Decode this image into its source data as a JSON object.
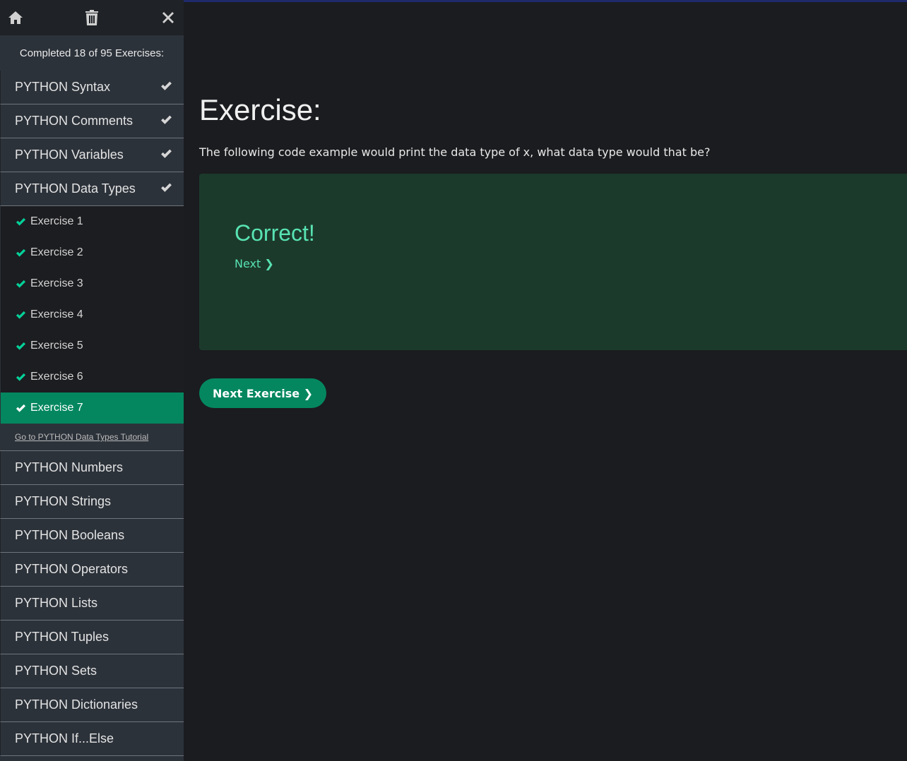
{
  "toolbar": {
    "home_icon": "home-icon",
    "trash_icon": "trash-icon",
    "close_icon": "close-icon"
  },
  "progress_text": "Completed 18 of 95 Exercises:",
  "sections_top": [
    {
      "label": "PYTHON Syntax",
      "completed": true
    },
    {
      "label": "PYTHON Comments",
      "completed": true
    },
    {
      "label": "PYTHON Variables",
      "completed": true
    },
    {
      "label": "PYTHON Data Types",
      "completed": true
    }
  ],
  "sub_exercises": [
    {
      "label": "Exercise 1"
    },
    {
      "label": "Exercise 2"
    },
    {
      "label": "Exercise 3"
    },
    {
      "label": "Exercise 4"
    },
    {
      "label": "Exercise 5"
    },
    {
      "label": "Exercise 6"
    },
    {
      "label": "Exercise 7"
    }
  ],
  "tutorial_link": "Go to PYTHON Data Types Tutorial",
  "sections_bottom": [
    {
      "label": "PYTHON Numbers"
    },
    {
      "label": "PYTHON Strings"
    },
    {
      "label": "PYTHON Booleans"
    },
    {
      "label": "PYTHON Operators"
    },
    {
      "label": "PYTHON Lists"
    },
    {
      "label": "PYTHON Tuples"
    },
    {
      "label": "PYTHON Sets"
    },
    {
      "label": "PYTHON Dictionaries"
    },
    {
      "label": "PYTHON If...Else"
    }
  ],
  "main": {
    "title": "Exercise:",
    "question": "The following code example would print the data type of x, what data type would that be?",
    "result_title": "Correct!",
    "next_link": "Next ❯",
    "next_button": "Next Exercise ❯"
  },
  "colors": {
    "accent": "#04875f",
    "check": "#04d19a",
    "correct_text": "#58e3b3",
    "result_bg": "#1c3a2c"
  }
}
